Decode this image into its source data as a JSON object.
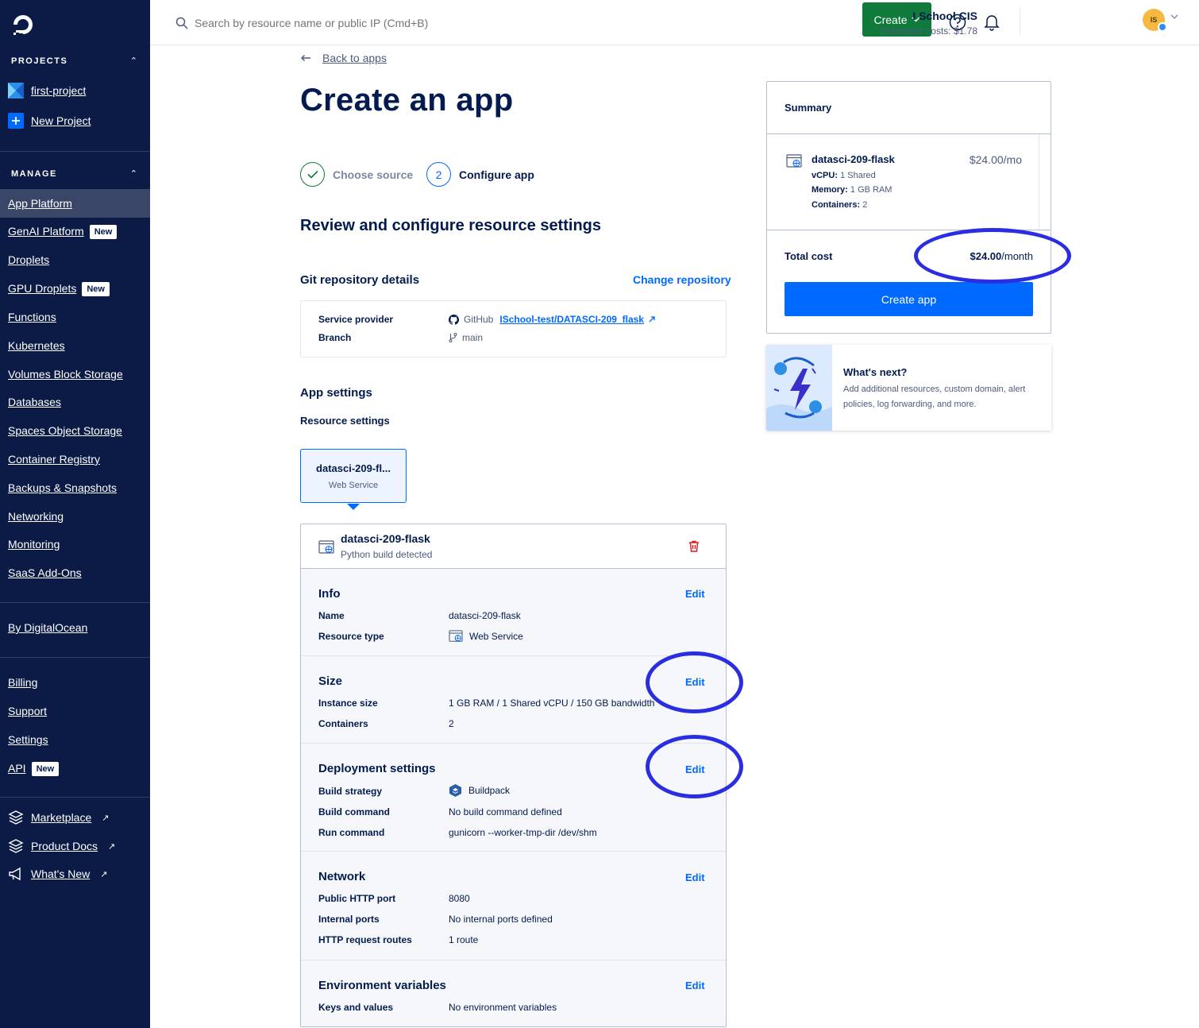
{
  "topbar": {
    "search_placeholder": "Search by resource name or public IP (Cmd+B)",
    "create_label": "Create",
    "account_name": "I School CIS",
    "estimated_costs": "Estimated costs: $1.78",
    "avatar_initials": "IS"
  },
  "sidebar": {
    "projects_heading": "PROJECTS",
    "projects": [
      {
        "label": "first-project"
      },
      {
        "label": "New Project"
      }
    ],
    "manage_heading": "MANAGE",
    "manage_items": [
      {
        "label": "App Platform",
        "active": true
      },
      {
        "label": "GenAI Platform",
        "badge": "New"
      },
      {
        "label": "Droplets"
      },
      {
        "label": "GPU Droplets",
        "badge": "New"
      },
      {
        "label": "Functions"
      },
      {
        "label": "Kubernetes"
      },
      {
        "label": "Volumes Block Storage"
      },
      {
        "label": "Databases"
      },
      {
        "label": "Spaces Object Storage"
      },
      {
        "label": "Container Registry"
      },
      {
        "label": "Backups & Snapshots"
      },
      {
        "label": "Networking"
      },
      {
        "label": "Monitoring"
      },
      {
        "label": "SaaS Add-Ons"
      }
    ],
    "by_digitalocean": "By DigitalOcean",
    "account_items": [
      {
        "label": "Billing"
      },
      {
        "label": "Support"
      },
      {
        "label": "Settings"
      },
      {
        "label": "API",
        "badge": "New"
      }
    ],
    "external_items": [
      {
        "label": "Marketplace",
        "icon": "marketplace-icon"
      },
      {
        "label": "Product Docs",
        "icon": "docs-icon"
      },
      {
        "label": "What's New",
        "icon": "megaphone-icon"
      }
    ],
    "external_arrow": "↗"
  },
  "main": {
    "back_link": "Back to apps",
    "title": "Create an app",
    "steps": [
      {
        "number": "✓",
        "label": "Choose source",
        "state": "done"
      },
      {
        "number": "2",
        "label": "Configure app",
        "state": "current"
      }
    ],
    "review_heading": "Review and configure resource settings",
    "git_heading": "Git repository details",
    "change_repository": "Change repository",
    "git": {
      "service_provider_label": "Service provider",
      "provider": "GitHub",
      "repo": "ISchool-test/DATASCI-209_flask",
      "branch_label": "Branch",
      "branch": "main"
    },
    "app_settings_heading": "App settings",
    "resource_settings_heading": "Resource settings",
    "resource_card": {
      "title": "datasci-209-fl...",
      "subtitle": "Web Service"
    },
    "component": {
      "name": "datasci-209-flask",
      "subtitle": "Python build detected"
    },
    "edit_label": "Edit",
    "sections": {
      "info": {
        "title": "Info",
        "rows": [
          {
            "label": "Name",
            "value": "datasci-209-flask"
          },
          {
            "label": "Resource type",
            "value": "Web Service"
          }
        ]
      },
      "size": {
        "title": "Size",
        "rows": [
          {
            "label": "Instance size",
            "value": "1 GB RAM / 1 Shared vCPU / 150 GB bandwidth"
          },
          {
            "label": "Containers",
            "value": "2"
          }
        ]
      },
      "deployment": {
        "title": "Deployment settings",
        "rows": [
          {
            "label": "Build strategy",
            "value": "Buildpack"
          },
          {
            "label": "Build command",
            "value": "No build command defined"
          },
          {
            "label": "Run command",
            "value": "gunicorn --worker-tmp-dir /dev/shm"
          }
        ]
      },
      "network": {
        "title": "Network",
        "rows": [
          {
            "label": "Public HTTP port",
            "value": "8080"
          },
          {
            "label": "Internal ports",
            "value": "No internal ports defined"
          },
          {
            "label": "HTTP request routes",
            "value": "1 route"
          }
        ]
      },
      "env": {
        "title": "Environment variables",
        "rows": [
          {
            "label": "Keys and values",
            "value": "No environment variables"
          }
        ]
      }
    }
  },
  "summary": {
    "title": "Summary",
    "component_name": "datasci-209-flask",
    "price": "$24.00/mo",
    "vcpu_label": "vCPU:",
    "vcpu": "1 Shared",
    "memory_label": "Memory:",
    "memory": "1 GB RAM",
    "containers_label": "Containers:",
    "containers": "2",
    "total_label": "Total cost",
    "total_amount": "$24.00",
    "total_unit": "/month",
    "create_app_label": "Create app"
  },
  "whats_next": {
    "title": "What's next?",
    "description": "Add additional resources, custom domain, alert policies, log forwarding, and more."
  },
  "colors": {
    "sidebar_bg": "#0b1b45",
    "primary_blue": "#0069ff",
    "create_green": "#0f7a3a",
    "annotation_blue": "#2b2ee0"
  }
}
